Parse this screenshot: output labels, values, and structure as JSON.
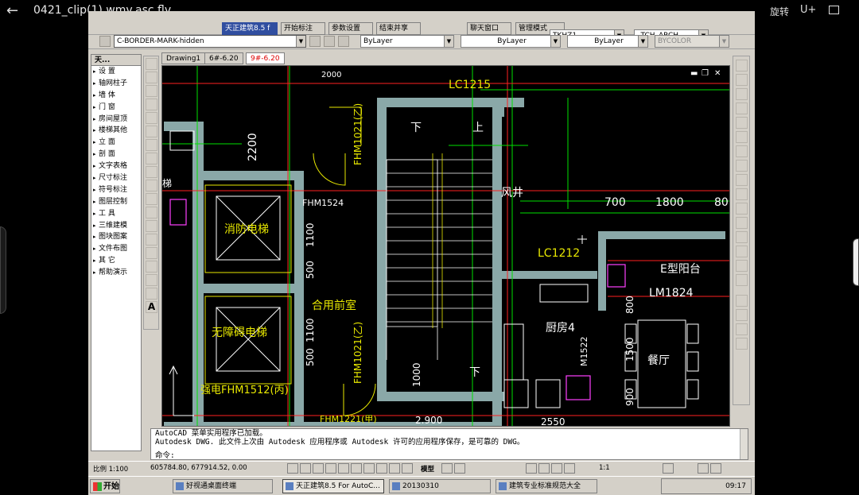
{
  "player": {
    "title": "0421_clip(1).wmv.asc.flv",
    "rotate": "旋转",
    "uplus": "U+"
  },
  "toolbar": {
    "top_tabs": [
      "天正建筑8.5 f",
      "开始标注",
      "参数设置",
      "结束并享",
      "聊天窗口",
      "管理模式"
    ],
    "layer_combo": "C-BORDER-MARK-hidden",
    "color_combo": "ByLayer",
    "linetype_combo": "ByLayer",
    "lineweight_combo": "ByLayer",
    "plotstyle_combo": "BYCOLOR",
    "style_combo_1": "TKHZ1",
    "style_combo_2": "_TCH_ARCH"
  },
  "menu": {
    "header": "天...",
    "items": [
      "设  置",
      "轴网柱子",
      "墙  体",
      "门  窗",
      "房间屋顶",
      "楼梯其他",
      "立  面",
      "剖  面",
      "文字表格",
      "尺寸标注",
      "符号标注",
      "图层控制",
      "工  具",
      "三维建模",
      "图块图案",
      "文件布图",
      "其  它",
      "帮助演示"
    ]
  },
  "tabs": [
    "Drawing1",
    "6#-6.20",
    "9#-6.20"
  ],
  "drawing": {
    "labels": {
      "lc1215": "LC1215",
      "shang": "上",
      "xia": "下",
      "fhm1021": "FHM1021(乙)",
      "fhm1021b": "FHM1021(乙)",
      "fhm1524": "FHM1524",
      "fengjing": "风井",
      "d700": "700",
      "d1800": "1800",
      "d80": "80",
      "d2200": "2200",
      "d2000": "2000",
      "xiaofang": "消防电梯",
      "wuzhang": "无障碍电梯",
      "hejin": "合用前室",
      "lc1212": "LC1212",
      "eyangtai": "E型阳台",
      "lm1824": "LM1824",
      "chufang": "厨房4",
      "m1522": "M1522",
      "canting": "餐厅",
      "d1100": "1100",
      "d500": "500",
      "d1000": "1000",
      "d1500": "1500",
      "d900": "900",
      "d800": "800",
      "d2900": "2.900",
      "d2550": "2550",
      "fhm1512": "强电FHM1512(丙)",
      "fhm1221": "FHM1221(甲)",
      "sheng": "梯"
    }
  },
  "command": {
    "line1": "AutoCAD 菜单实用程序已加载。",
    "line2": "Autodesk DWG.   此文件上次由 Autodesk 应用程序或 Autodesk 许可的应用程序保存，是可靠的 DWG。",
    "prompt": "命令:"
  },
  "status": {
    "scale": "比例 1:100",
    "coords": "605784.80, 677914.52, 0.00",
    "model": "模型",
    "anno": "1:1"
  },
  "taskbar": {
    "start": "开始",
    "tasks": [
      "好视通桌面终端",
      "天正建筑8.5 For AutoC...",
      "20130310",
      "建筑专业标准规范大全"
    ],
    "clock": "09:17"
  },
  "colors": {
    "wall": "#8aa8a8",
    "green": "#00e000",
    "red": "#ff2020",
    "yellow": "#e8e800",
    "magenta": "#ff40ff",
    "white": "#ffffff",
    "cyan": "#00d8d8"
  }
}
